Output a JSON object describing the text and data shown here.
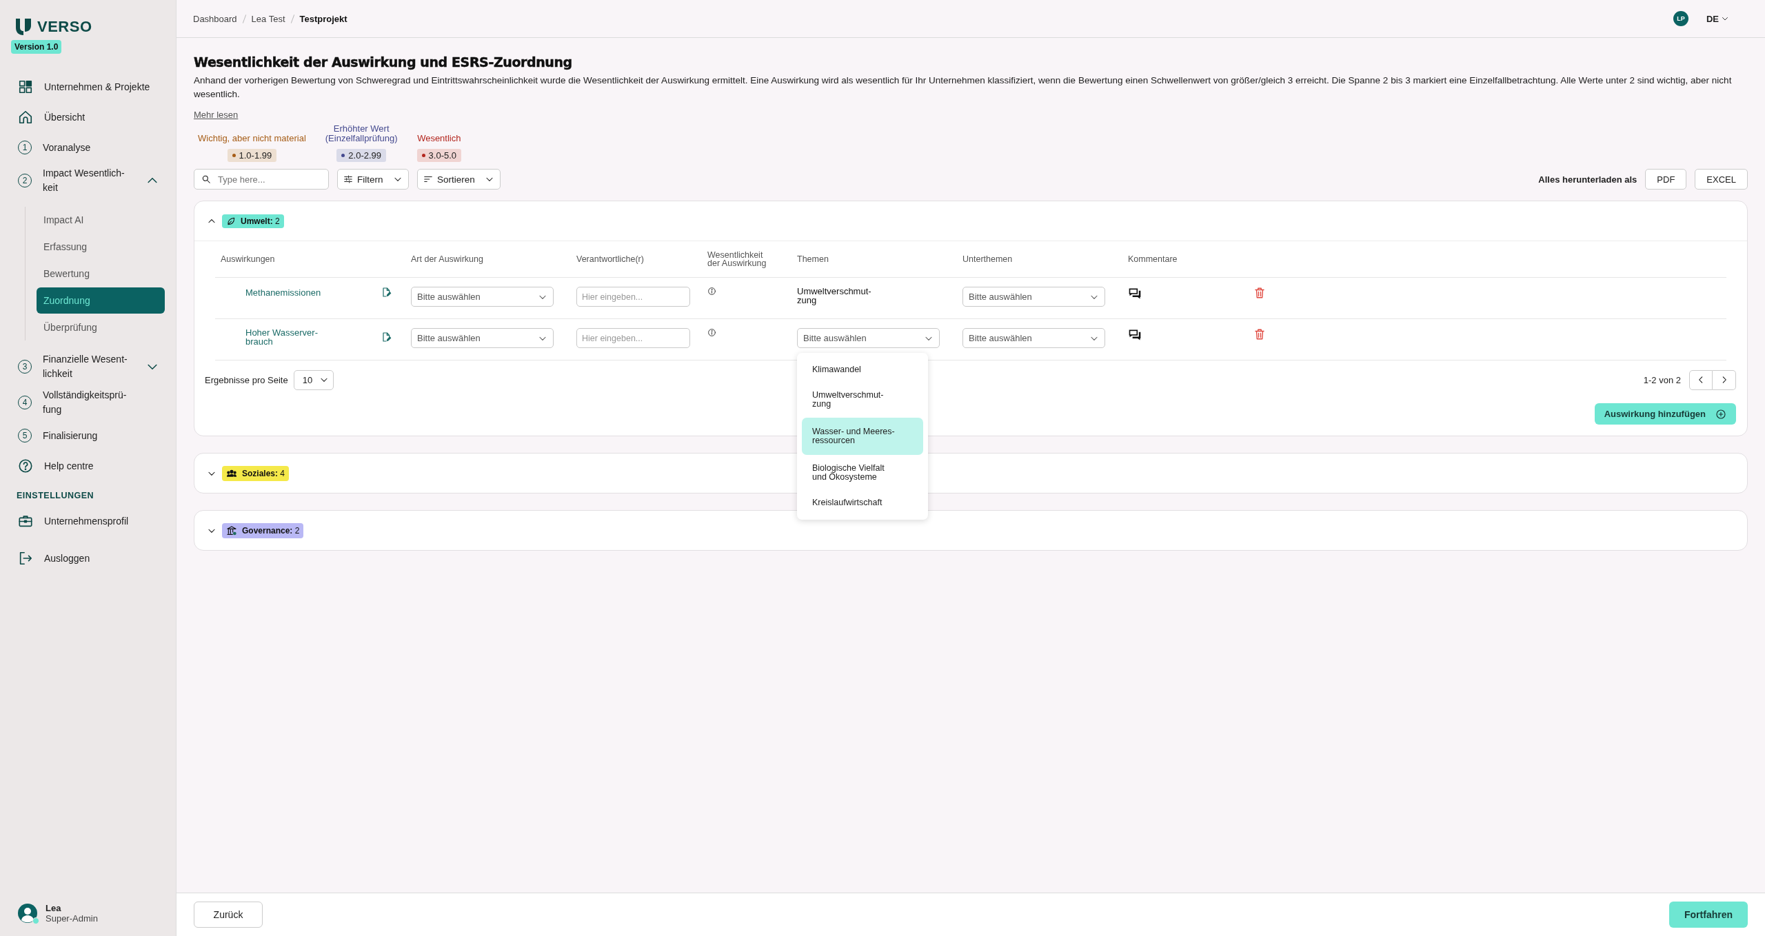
{
  "sidebar": {
    "logo": "VERSO",
    "version": "Version 1.0",
    "nav": [
      {
        "kind": "grid",
        "label": "Unternehmen & Projekte"
      },
      {
        "kind": "home",
        "label": "Übersicht"
      },
      {
        "kind": "step",
        "number": "1",
        "label": "Voranalyse"
      },
      {
        "kind": "step",
        "number": "2",
        "label": "Impact Wesentlich-\nkeit",
        "expanded": true,
        "children": [
          {
            "label": "Impact AI",
            "selected": false
          },
          {
            "label": "Erfassung",
            "selected": false
          },
          {
            "label": "Bewertung",
            "selected": false
          },
          {
            "label": "Zuordnung",
            "selected": true
          },
          {
            "label": "Überprüfung",
            "selected": false
          }
        ]
      },
      {
        "kind": "step",
        "number": "3",
        "label": "Finanzielle Wesent-\nlichkeit",
        "expanded": false
      },
      {
        "kind": "step",
        "number": "4",
        "label": "Vollständigkeitsprü-\nfung"
      },
      {
        "kind": "step",
        "number": "5",
        "label": "Finalisierung"
      },
      {
        "kind": "help",
        "label": "Help centre"
      }
    ],
    "settings_heading": "EINSTELLUNGEN",
    "settings": [
      {
        "kind": "briefcase",
        "label": "Unternehmensprofil"
      },
      {
        "kind": "logout",
        "label": "Ausloggen"
      }
    ],
    "user": {
      "name": "Lea",
      "role": "Super-Admin",
      "online": true
    }
  },
  "header": {
    "breadcrumbs": [
      "Dashboard",
      "Lea Test",
      "Testprojekt"
    ],
    "avatar": "LP",
    "language": "DE"
  },
  "page": {
    "title": "Wesentlichkeit der Auswirkung und ESRS-Zuordnung",
    "description": "Anhand der vorherigen Bewertung von Schweregrad und Eintrittswahrscheinlichkeit wurde die Wesentlichkeit der Auswirkung ermittelt. Eine Auswirkung wird als wesentlich für Ihr Unternehmen klassifiziert, wenn die Bewertung einen Schwellenwert von größer/gleich 3 erreicht. Die Spanne 2 bis 3 markiert eine Einzelfallbetrachtung. Alle Werte unter 2 sind wichtig, aber nicht wesentlich.",
    "more_link": "Mehr lesen",
    "legend": [
      {
        "label": "Wichtig, aber nicht material",
        "range": "1.0-1.99",
        "color": "#a65d17"
      },
      {
        "label": "Erhöhter Wert\n(Einzelfallprüfung)",
        "range": "2.0-2.99",
        "color": "#454a8f"
      },
      {
        "label": "Wesentlich",
        "range": "3.0-5.0",
        "color": "#b3261e"
      }
    ],
    "search": {
      "placeholder": "Type here..."
    },
    "filter": "Filtern",
    "sort": "Sortieren",
    "download_label": "Alles herunterladen als",
    "download_buttons": [
      "PDF",
      "EXCEL"
    ]
  },
  "groups": [
    {
      "kind": "environment",
      "label": "Umwelt:",
      "count": "2",
      "color": "#6ee6d2",
      "expanded": true,
      "columns": [
        "Auswirkungen",
        "Art der Auswirkung",
        "Verantwortliche(r)",
        "Wesentlichkeit\nder Auswirkung",
        "Themen",
        "Unterthemen",
        "Kommentare"
      ],
      "rows": [
        {
          "impact": "Methanemissionen",
          "type": {
            "placeholder": "Bitte auswählen"
          },
          "responsible": {
            "placeholder": "Hier eingeben..."
          },
          "topic": {
            "kind": "text",
            "value": "Umweltverschmut-\nzung"
          },
          "subtopic": {
            "placeholder": "Bitte auswählen"
          }
        },
        {
          "impact": "Hoher Wasserver-\nbrauch",
          "type": {
            "placeholder": "Bitte auswählen"
          },
          "responsible": {
            "placeholder": "Hier eingeben..."
          },
          "topic": {
            "kind": "select",
            "placeholder": "Bitte auswählen",
            "expanded": true,
            "options": [
              {
                "label": "Klimawandel",
                "selected": false
              },
              {
                "label": "Umweltverschmut-\nzung",
                "selected": false
              },
              {
                "label": "Wasser- und Meeres-\nressourcen",
                "selected": true
              },
              {
                "label": "Biologische Vielfalt\nund Ökosysteme",
                "selected": false
              },
              {
                "label": "Kreislaufwirtschaft",
                "selected": false
              }
            ]
          },
          "subtopic": {
            "placeholder": "Bitte auswählen"
          }
        }
      ],
      "page_size_label": "Ergebnisse pro Seite",
      "page_size": "10",
      "range": "1-2 von 2",
      "add_button": "Auswirkung hinzufügen"
    },
    {
      "kind": "social",
      "label": "Soziales:",
      "count": "4",
      "color": "#f5e94a",
      "expanded": false
    },
    {
      "kind": "governance",
      "label": "Governance:",
      "count": "2",
      "color": "#b9b8f5",
      "expanded": false
    }
  ],
  "footer": {
    "back": "Zurück",
    "next": "Fortfahren"
  }
}
